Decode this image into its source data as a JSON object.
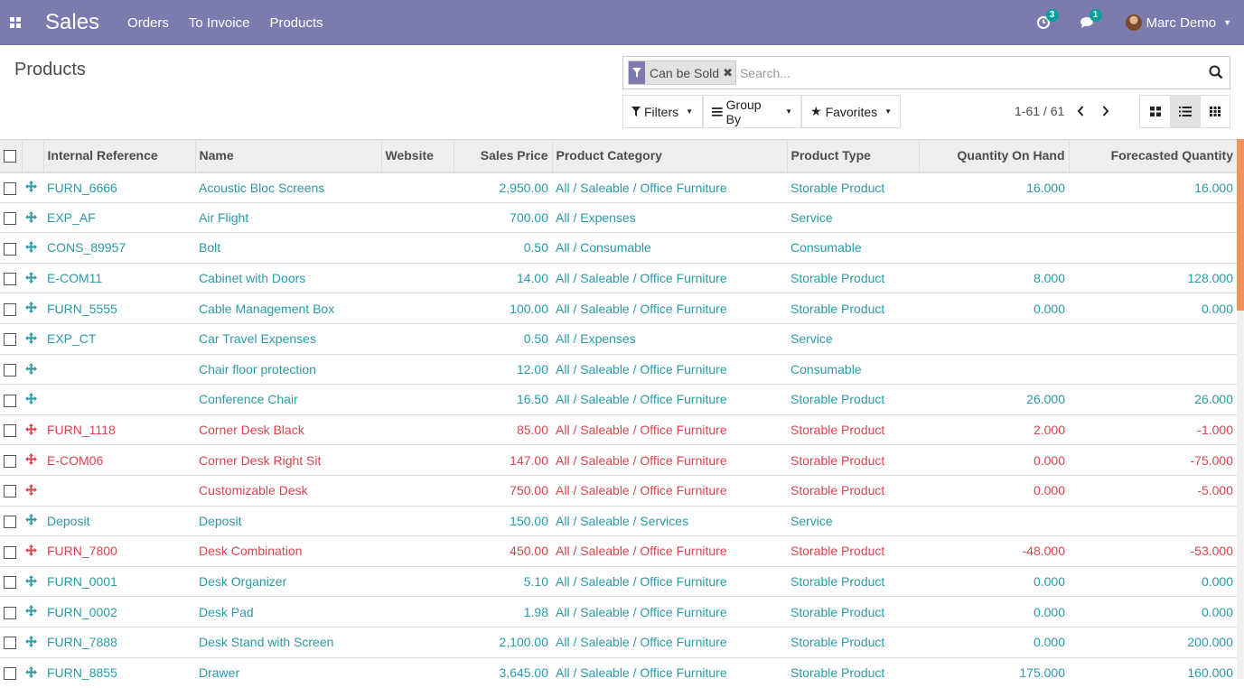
{
  "navbar": {
    "brand": "Sales",
    "menu": [
      "Orders",
      "To Invoice",
      "Products"
    ],
    "activity_count": "3",
    "messages_count": "1",
    "user_name": "Marc Demo"
  },
  "control_panel": {
    "title": "Products",
    "facet_label": "Can be Sold",
    "search_placeholder": "Search...",
    "filters_label": "Filters",
    "groupby_label": "Group By",
    "favorites_label": "Favorites",
    "pager_text": "1-61 / 61"
  },
  "colors": {
    "navbar": "#7c7bad",
    "link": "#2a9aa8",
    "danger": "#d9454d",
    "badge": "#00a09d",
    "scrollbar": "#f0925c"
  },
  "columns": [
    "Internal Reference",
    "Name",
    "Website",
    "Sales Price",
    "Product Category",
    "Product Type",
    "Quantity On Hand",
    "Forecasted Quantity"
  ],
  "rows": [
    {
      "ref": "FURN_6666",
      "name": "Acoustic Bloc Screens",
      "website": "",
      "price": "2,950.00",
      "category": "All / Saleable / Office Furniture",
      "type": "Storable Product",
      "qty": "16.000",
      "forecast": "16.000",
      "danger": false
    },
    {
      "ref": "EXP_AF",
      "name": "Air Flight",
      "website": "",
      "price": "700.00",
      "category": "All / Expenses",
      "type": "Service",
      "qty": "",
      "forecast": "",
      "danger": false
    },
    {
      "ref": "CONS_89957",
      "name": "Bolt",
      "website": "",
      "price": "0.50",
      "category": "All / Consumable",
      "type": "Consumable",
      "qty": "",
      "forecast": "",
      "danger": false
    },
    {
      "ref": "E-COM11",
      "name": "Cabinet with Doors",
      "website": "",
      "price": "14.00",
      "category": "All / Saleable / Office Furniture",
      "type": "Storable Product",
      "qty": "8.000",
      "forecast": "128.000",
      "danger": false
    },
    {
      "ref": "FURN_5555",
      "name": "Cable Management Box",
      "website": "",
      "price": "100.00",
      "category": "All / Saleable / Office Furniture",
      "type": "Storable Product",
      "qty": "0.000",
      "forecast": "0.000",
      "danger": false
    },
    {
      "ref": "EXP_CT",
      "name": "Car Travel Expenses",
      "website": "",
      "price": "0.50",
      "category": "All / Expenses",
      "type": "Service",
      "qty": "",
      "forecast": "",
      "danger": false
    },
    {
      "ref": "",
      "name": "Chair floor protection",
      "website": "",
      "price": "12.00",
      "category": "All / Saleable / Office Furniture",
      "type": "Consumable",
      "qty": "",
      "forecast": "",
      "danger": false
    },
    {
      "ref": "",
      "name": "Conference Chair",
      "website": "",
      "price": "16.50",
      "category": "All / Saleable / Office Furniture",
      "type": "Storable Product",
      "qty": "26.000",
      "forecast": "26.000",
      "danger": false
    },
    {
      "ref": "FURN_1118",
      "name": "Corner Desk Black",
      "website": "",
      "price": "85.00",
      "category": "All / Saleable / Office Furniture",
      "type": "Storable Product",
      "qty": "2.000",
      "forecast": "-1.000",
      "danger": true
    },
    {
      "ref": "E-COM06",
      "name": "Corner Desk Right Sit",
      "website": "",
      "price": "147.00",
      "category": "All / Saleable / Office Furniture",
      "type": "Storable Product",
      "qty": "0.000",
      "forecast": "-75.000",
      "danger": true
    },
    {
      "ref": "",
      "name": "Customizable Desk",
      "website": "",
      "price": "750.00",
      "category": "All / Saleable / Office Furniture",
      "type": "Storable Product",
      "qty": "0.000",
      "forecast": "-5.000",
      "danger": true
    },
    {
      "ref": "Deposit",
      "name": "Deposit",
      "website": "",
      "price": "150.00",
      "category": "All / Saleable / Services",
      "type": "Service",
      "qty": "",
      "forecast": "",
      "danger": false
    },
    {
      "ref": "FURN_7800",
      "name": "Desk Combination",
      "website": "",
      "price": "450.00",
      "category": "All / Saleable / Office Furniture",
      "type": "Storable Product",
      "qty": "-48.000",
      "forecast": "-53.000",
      "danger": true
    },
    {
      "ref": "FURN_0001",
      "name": "Desk Organizer",
      "website": "",
      "price": "5.10",
      "category": "All / Saleable / Office Furniture",
      "type": "Storable Product",
      "qty": "0.000",
      "forecast": "0.000",
      "danger": false
    },
    {
      "ref": "FURN_0002",
      "name": "Desk Pad",
      "website": "",
      "price": "1.98",
      "category": "All / Saleable / Office Furniture",
      "type": "Storable Product",
      "qty": "0.000",
      "forecast": "0.000",
      "danger": false
    },
    {
      "ref": "FURN_7888",
      "name": "Desk Stand with Screen",
      "website": "",
      "price": "2,100.00",
      "category": "All / Saleable / Office Furniture",
      "type": "Storable Product",
      "qty": "0.000",
      "forecast": "200.000",
      "danger": false
    },
    {
      "ref": "FURN_8855",
      "name": "Drawer",
      "website": "",
      "price": "3,645.00",
      "category": "All / Saleable / Office Furniture",
      "type": "Storable Product",
      "qty": "175.000",
      "forecast": "160.000",
      "danger": false
    }
  ]
}
